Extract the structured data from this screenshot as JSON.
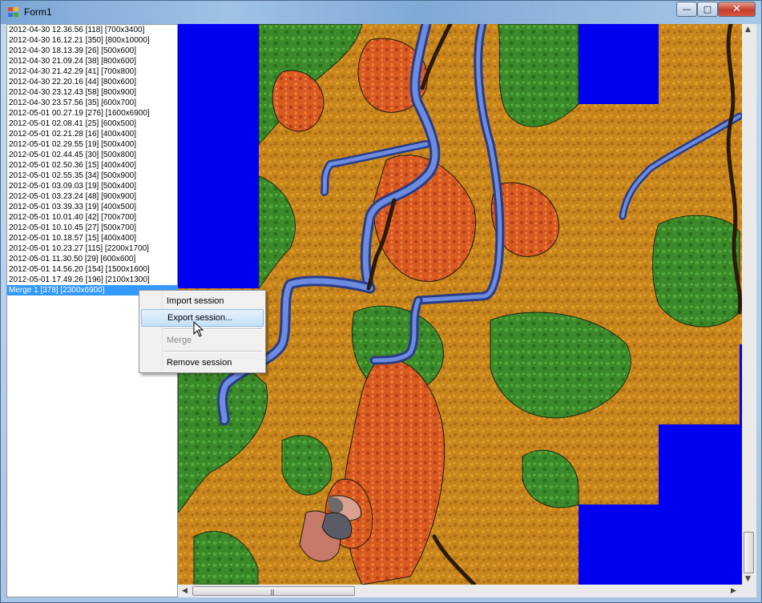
{
  "window": {
    "title": "Form1",
    "controls": {
      "minimize": "—",
      "maximize": "□",
      "close": "✕"
    }
  },
  "sessions": [
    "2012-04-30 12.36.56 [118] [700x3400]",
    "2012-04-30 16.12.21 [350] [800x10000]",
    "2012-04-30 18.13.39 [26] [500x600]",
    "2012-04-30 21.09.24 [38] [800x600]",
    "2012-04-30 21.42.29 [41] [700x800]",
    "2012-04-30 22.20.16 [44] [800x600]",
    "2012-04-30 23.12.43 [58] [800x900]",
    "2012-04-30 23.57.56 [35] [600x700]",
    "2012-05-01 00.27.19 [276] [1600x6900]",
    "2012-05-01 02.08.41 [25] [600x500]",
    "2012-05-01 02.21.28 [16] [400x400]",
    "2012-05-01 02.29.55 [19] [500x400]",
    "2012-05-01 02.44.45 [30] [500x800]",
    "2012-05-01 02.50.36 [15] [400x400]",
    "2012-05-01 02.55.35 [34] [500x900]",
    "2012-05-01 03.09.03 [19] [500x400]",
    "2012-05-01 03.23.24 [48] [900x900]",
    "2012-05-01 03.39.33 [19] [400x500]",
    "2012-05-01 10.01.40 [42] [700x700]",
    "2012-05-01 10.10.45 [27] [500x700]",
    "2012-05-01 10.18.57 [15] [400x400]",
    "2012-05-01 10.23.27 [115] [2200x1700]",
    "2012-05-01 11.30.50 [29] [600x600]",
    "2012-05-01 14.56.20 [154] [1500x1600]",
    "2012-05-01 17.49.26 [196] [2100x1300]"
  ],
  "selected_session": "Merge 1 [378] [2300x6900]",
  "context_menu": {
    "import": "Import session",
    "export": "Export session...",
    "merge": "Merge",
    "remove": "Remove session"
  },
  "colors": {
    "selection": "#3399ff",
    "map_background": "#0000f0",
    "terrain_orange": "#c8861c",
    "terrain_red": "#d85a22",
    "terrain_green": "#3b8a2a",
    "river": "#4a64b8"
  }
}
